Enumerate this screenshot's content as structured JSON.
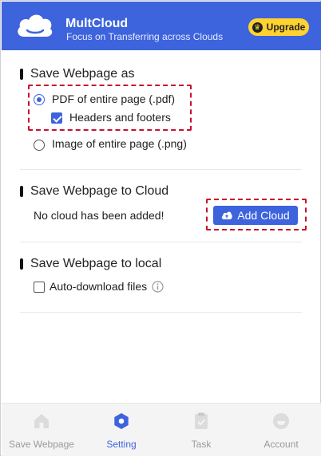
{
  "header": {
    "brand_name": "MultCloud",
    "tagline": "Focus on Transferring across Clouds",
    "upgrade_label": "Upgrade",
    "bg_color": "#3d63dd"
  },
  "save_as": {
    "title": "Save Webpage as",
    "options": [
      {
        "label": "PDF of entire page (.pdf)",
        "selected": true
      },
      {
        "label": "Image of entire page (.png)",
        "selected": false
      }
    ],
    "headers_footers": {
      "label": "Headers and footers",
      "checked": true
    }
  },
  "save_to_cloud": {
    "title": "Save Webpage to Cloud",
    "status": "No cloud has been added!",
    "add_cloud_label": "Add Cloud"
  },
  "save_to_local": {
    "title": "Save Webpage to local",
    "auto_download": {
      "label": "Auto-download files",
      "checked": false
    }
  },
  "nav": {
    "items": [
      {
        "label": "Save Webpage",
        "icon": "home-icon",
        "active": false
      },
      {
        "label": "Setting",
        "icon": "settings-icon",
        "active": true
      },
      {
        "label": "Task",
        "icon": "task-icon",
        "active": false
      },
      {
        "label": "Account",
        "icon": "account-icon",
        "active": false
      }
    ]
  },
  "colors": {
    "accent": "#3d63dd",
    "upgrade": "#ffd230",
    "highlight_border": "#c8102e"
  }
}
